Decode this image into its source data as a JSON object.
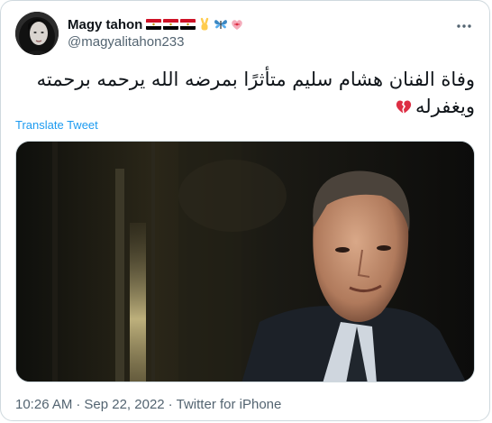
{
  "user": {
    "display_name": "Magy tahon",
    "handle": "@magyalitahon233",
    "badges": [
      "egypt-flag-icon",
      "egypt-flag-icon",
      "egypt-flag-icon",
      "victory-hand-icon",
      "blue-butterfly-icon",
      "heart-with-ribbon-icon"
    ]
  },
  "tweet": {
    "text_line1": "وفاة الفنان هشام سليم متأثرًا بمرضه الله يرحمه برحمته",
    "text_line2": "ويغفرله",
    "trailing_emoji": "broken-heart-icon",
    "translate_label": "Translate Tweet"
  },
  "media": {
    "icon": "photo-portrait-image"
  },
  "meta": {
    "time": "10:26 AM",
    "separator": "·",
    "date": "Sep 22, 2022",
    "source": "Twitter for iPhone"
  },
  "colors": {
    "link": "#1d9bf0",
    "secondary_text": "#536471",
    "border": "#cfd9de",
    "heart": "#dd2e44"
  }
}
